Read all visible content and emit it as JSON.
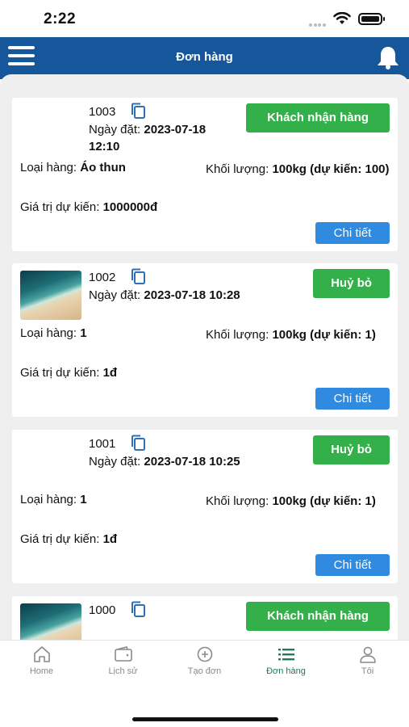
{
  "status_bar": {
    "time": "2:22"
  },
  "header": {
    "title": "Đơn hàng"
  },
  "labels": {
    "date": "Ngày đặt:",
    "type": "Loại hàng:",
    "weight": "Khối lượng:",
    "value": "Giá trị dự kiến:",
    "detail_button": "Chi tiết"
  },
  "orders": [
    {
      "id": "1003",
      "date_line1": "2023-07-18",
      "date_line2": "12:10",
      "action": "Khách nhận hàng",
      "type": "Áo thun",
      "weight": "100kg (dự kiến: 100)",
      "value": "1000000đ",
      "has_thumb": false
    },
    {
      "id": "1002",
      "date_line1": "2023-07-18 10:28",
      "date_line2": "",
      "action": "Huỷ bỏ",
      "type": "1",
      "weight": "100kg (dự kiến: 1)",
      "value": "1đ",
      "has_thumb": true
    },
    {
      "id": "1001",
      "date_line1": "2023-07-18 10:25",
      "date_line2": "",
      "action": "Huỷ bỏ",
      "type": "1",
      "weight": "100kg (dự kiến: 1)",
      "value": "1đ",
      "has_thumb": false
    },
    {
      "id": "1000",
      "action": "Khách nhận hàng",
      "has_thumb": true
    }
  ],
  "tabbar": {
    "items": [
      {
        "label": "Home",
        "icon": "home-icon"
      },
      {
        "label": "Lịch sử",
        "icon": "wallet-icon"
      },
      {
        "label": "Tạo đơn",
        "icon": "plus-circle-icon"
      },
      {
        "label": "Đơn hàng",
        "icon": "list-icon",
        "active": true
      },
      {
        "label": "Tôi",
        "icon": "user-icon"
      }
    ]
  },
  "colors": {
    "header": "#16579b",
    "green": "#34b04a",
    "blue": "#2f8ae0",
    "active_tab": "#1f7a57"
  }
}
